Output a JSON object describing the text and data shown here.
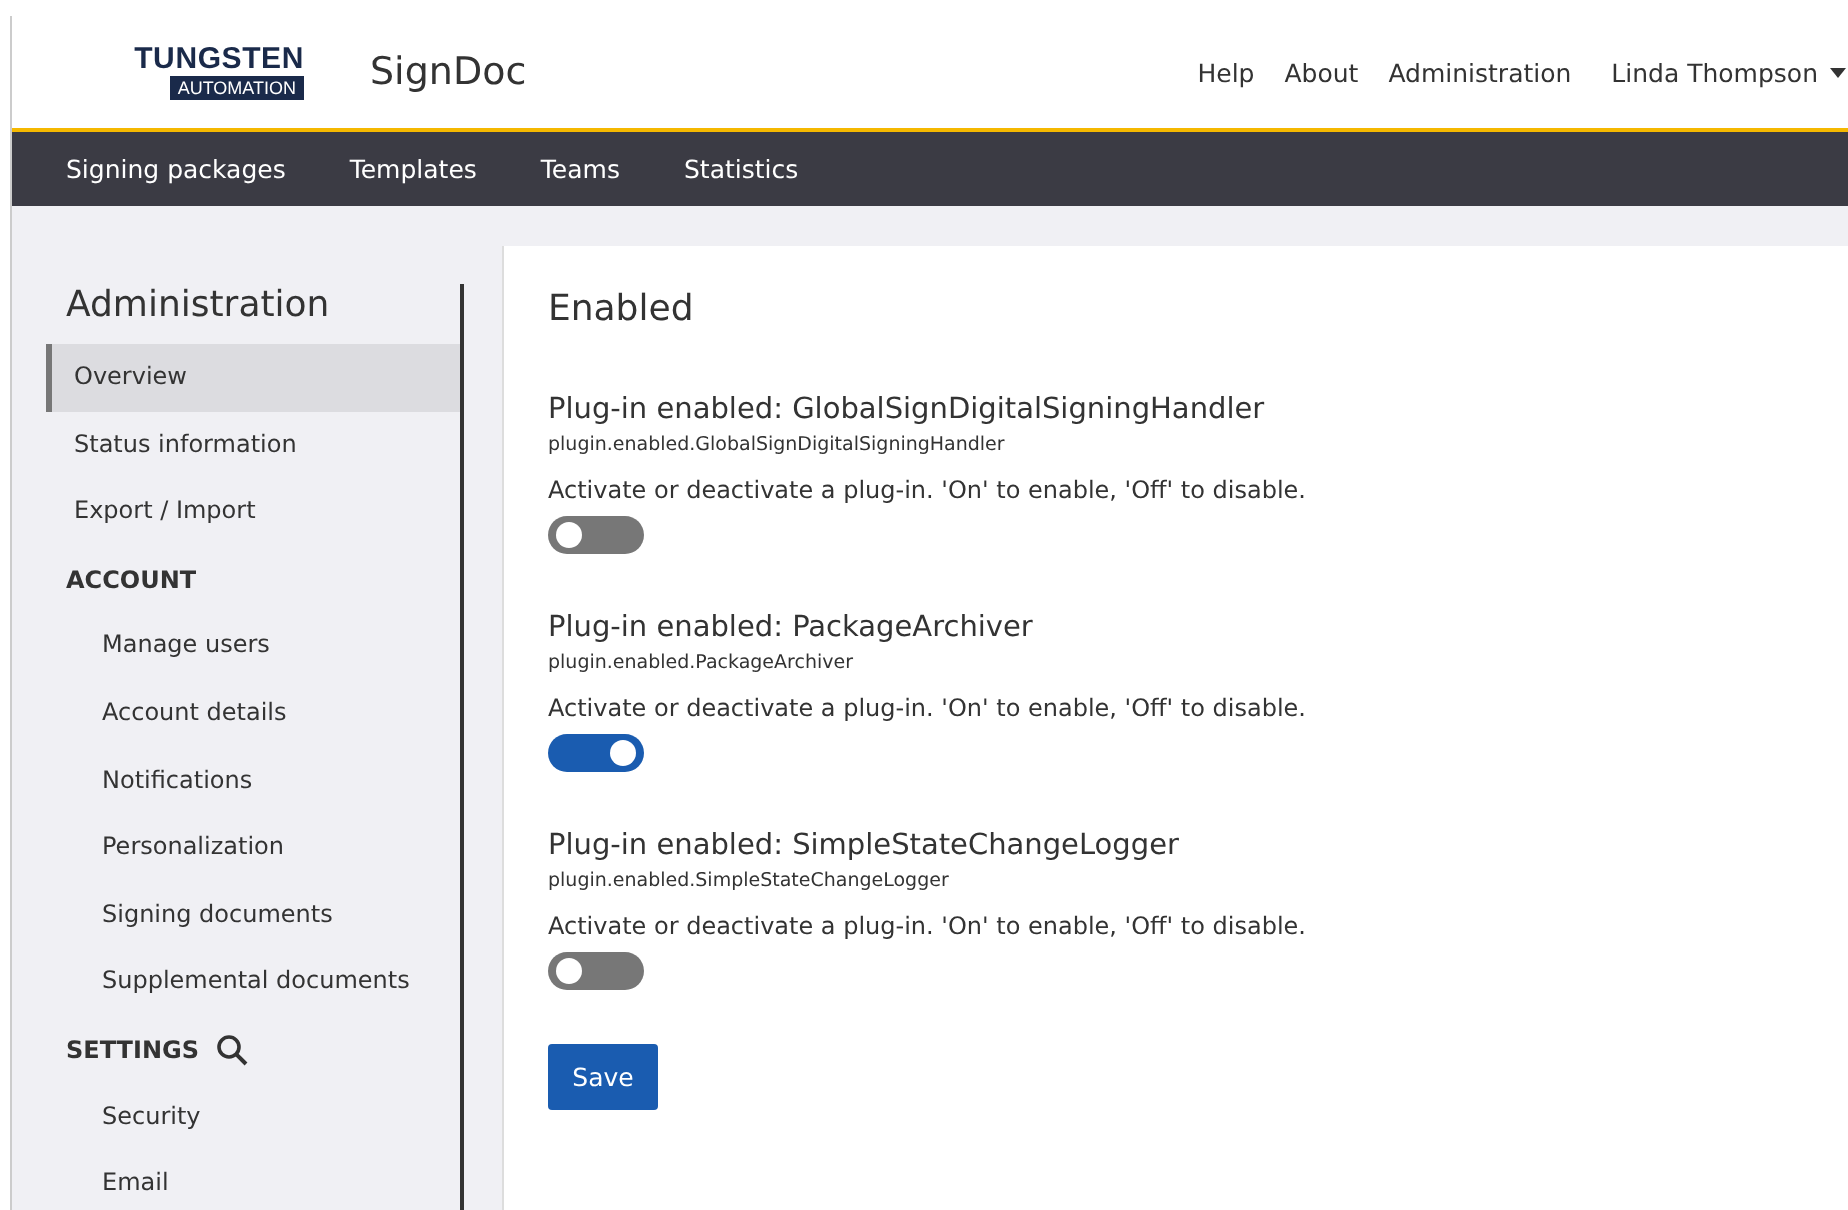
{
  "header": {
    "logo": {
      "top": "TUNGSTEN",
      "bottom": "AUTOMATION"
    },
    "app_name": "SignDoc",
    "links": [
      "Help",
      "About",
      "Administration"
    ],
    "user": "Linda Thompson"
  },
  "nav": [
    "Signing packages",
    "Templates",
    "Teams",
    "Statistics"
  ],
  "sidebar": {
    "title": "Administration",
    "items": [
      {
        "label": "Overview",
        "selected": true
      },
      {
        "label": "Status information",
        "selected": false
      },
      {
        "label": "Export / Import",
        "selected": false
      }
    ],
    "sections": [
      {
        "label": "ACCOUNT",
        "search": false,
        "children": [
          {
            "label": "Manage users",
            "selected": false
          },
          {
            "label": "Account details",
            "selected": false
          },
          {
            "label": "Notifications",
            "selected": false
          },
          {
            "label": "Personalization",
            "selected": false
          },
          {
            "label": "Signing documents",
            "selected": false
          },
          {
            "label": "Supplemental documents",
            "selected": false
          }
        ]
      },
      {
        "label": "SETTINGS",
        "search": true,
        "children": [
          {
            "label": "Security",
            "selected": false
          },
          {
            "label": "Email",
            "selected": false
          }
        ]
      }
    ]
  },
  "content": {
    "title": "Enabled",
    "plugins": [
      {
        "title": "Plug-in enabled: GlobalSignDigitalSigningHandler",
        "key": "plugin.enabled.GlobalSignDigitalSigningHandler",
        "description": "Activate or deactivate a plug-in. 'On' to enable, 'Off' to disable.",
        "on": false
      },
      {
        "title": "Plug-in enabled: PackageArchiver",
        "key": "plugin.enabled.PackageArchiver",
        "description": "Activate or deactivate a plug-in. 'On' to enable, 'Off' to disable.",
        "on": true
      },
      {
        "title": "Plug-in enabled: SimpleStateChangeLogger",
        "key": "plugin.enabled.SimpleStateChangeLogger",
        "description": "Activate or deactivate a plug-in. 'On' to enable, 'Off' to disable.",
        "on": false
      }
    ],
    "save": "Save"
  }
}
